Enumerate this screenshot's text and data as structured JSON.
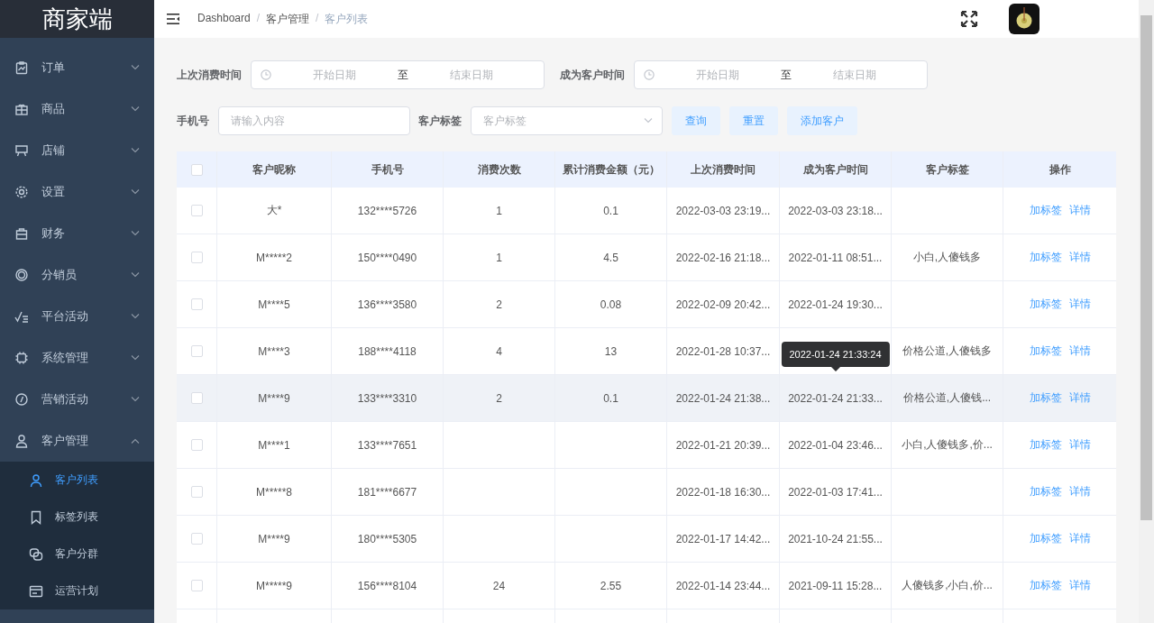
{
  "sidebar": {
    "logo": "商家端",
    "menu": [
      {
        "label": "订单",
        "expanded": false
      },
      {
        "label": "商品",
        "expanded": false
      },
      {
        "label": "店铺",
        "expanded": false
      },
      {
        "label": "设置",
        "expanded": false
      },
      {
        "label": "财务",
        "expanded": false
      },
      {
        "label": "分销员",
        "expanded": false
      },
      {
        "label": "平台活动",
        "expanded": false
      },
      {
        "label": "系统管理",
        "expanded": false
      },
      {
        "label": "营销活动",
        "expanded": false
      },
      {
        "label": "客户管理",
        "expanded": true,
        "children": [
          {
            "label": "客户列表",
            "selected": true
          },
          {
            "label": "标签列表",
            "selected": false
          },
          {
            "label": "客户分群",
            "selected": false
          },
          {
            "label": "运营计划",
            "selected": false
          }
        ]
      }
    ]
  },
  "header": {
    "breadcrumb": [
      "Dashboard",
      "客户管理",
      "客户列表"
    ],
    "separator": "/"
  },
  "filters": {
    "last_purchase": {
      "label": "上次消费时间",
      "start_placeholder": "开始日期",
      "separator": "至",
      "end_placeholder": "结束日期"
    },
    "join_time": {
      "label": "成为客户时间",
      "start_placeholder": "开始日期",
      "separator": "至",
      "end_placeholder": "结束日期"
    },
    "phone": {
      "label": "手机号",
      "placeholder": "请输入内容"
    },
    "tag": {
      "label": "客户标签",
      "placeholder": "客户标签"
    },
    "buttons": [
      "查询",
      "重置",
      "添加客户"
    ]
  },
  "table": {
    "header_checked": false,
    "columns": [
      "客户昵称",
      "手机号",
      "消费次数",
      "累计消费金额（元）",
      "上次消费时间",
      "成为客户时间",
      "客户标签",
      "操作"
    ],
    "rows": [
      {
        "checked": false,
        "hovered": false,
        "nickname": "大*",
        "phone": "132****5726",
        "count": "1",
        "amount": "0.1",
        "last_purchase": "2022-03-03 23:19...",
        "join_time": "2022-03-03 23:18...",
        "actions": [
          "加标签",
          "详情"
        ]
      },
      {
        "checked": false,
        "hovered": false,
        "nickname": "M*****2",
        "phone": "150****0490",
        "count": "1",
        "amount": "4.5",
        "last_purchase": "2022-02-16 21:18...",
        "join_time": "2022-01-11 08:51...",
        "tags": "小白,人傻钱多",
        "actions": [
          "加标签",
          "详情"
        ]
      },
      {
        "checked": false,
        "hovered": false,
        "nickname": "M****5",
        "phone": "136****3580",
        "count": "2",
        "amount": "0.08",
        "last_purchase": "2022-02-09 20:42...",
        "join_time": "2022-01-24 19:30...",
        "actions": [
          "加标签",
          "详情"
        ]
      },
      {
        "checked": false,
        "hovered": false,
        "nickname": "M****3",
        "phone": "188****4118",
        "count": "4",
        "amount": "13",
        "last_purchase": "2022-01-28 10:37...",
        "tags": "价格公道,人傻钱多",
        "actions": [
          "加标签",
          "详情"
        ]
      },
      {
        "checked": false,
        "hovered": true,
        "nickname": "M****9",
        "phone": "133****3310",
        "count": "2",
        "amount": "0.1",
        "last_purchase": "2022-01-24 21:38...",
        "join_time": "2022-01-24 21:33...",
        "tooltip": "2022-01-24 21:33:24",
        "tags": "价格公道,人傻钱...",
        "actions": [
          "加标签",
          "详情"
        ]
      },
      {
        "checked": false,
        "hovered": false,
        "nickname": "M****1",
        "phone": "133****7651",
        "last_purchase": "2022-01-21 20:39...",
        "join_time": "2022-01-04 23:46...",
        "tags": "小白,人傻钱多,价...",
        "actions": [
          "加标签",
          "详情"
        ]
      },
      {
        "checked": false,
        "hovered": false,
        "nickname": "M*****8",
        "phone": "181****6677",
        "last_purchase": "2022-01-18 16:30...",
        "join_time": "2022-01-03 17:41...",
        "actions": [
          "加标签",
          "详情"
        ]
      },
      {
        "checked": false,
        "hovered": false,
        "nickname": "M****9",
        "phone": "180****5305",
        "last_purchase": "2022-01-17 14:42...",
        "join_time": "2021-10-24 21:55...",
        "actions": [
          "加标签",
          "详情"
        ]
      },
      {
        "checked": false,
        "hovered": false,
        "nickname": "M*****9",
        "phone": "156****8104",
        "count": "24",
        "amount": "2.55",
        "last_purchase": "2022-01-14 23:44...",
        "join_time": "2021-09-11 15:28...",
        "tags": "人傻钱多,小白,价...",
        "actions": [
          "加标签",
          "详情"
        ]
      }
    ]
  }
}
